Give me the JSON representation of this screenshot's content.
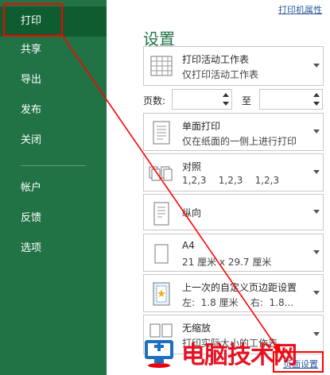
{
  "sidebar": {
    "items": [
      {
        "label": "打印",
        "active": true
      },
      {
        "label": "共享"
      },
      {
        "label": "导出"
      },
      {
        "label": "发布"
      },
      {
        "label": "关闭"
      },
      {
        "label": "帐户"
      },
      {
        "label": "反馈"
      },
      {
        "label": "选项"
      }
    ]
  },
  "main": {
    "printer_properties_link": "打印机属性",
    "section_title": "设置",
    "print_what": {
      "title": "打印活动工作表",
      "subtitle": "仅打印活动工作表"
    },
    "pages": {
      "label": "页数:",
      "to_label": "至",
      "from_value": "",
      "to_value": ""
    },
    "sides": {
      "title": "单面打印",
      "subtitle": "仅在纸面的一侧上进行打印"
    },
    "collation": {
      "title": "对照",
      "subtitle": "1,2,3    1,2,3    1,2,3"
    },
    "orientation": {
      "title": "纵向"
    },
    "paper": {
      "title": "A4",
      "subtitle": "21 厘米 x 29.7 厘米"
    },
    "margins": {
      "title": "上一次的自定义页边距设置",
      "subtitle": "左:  1.8 厘米    右:  1.8..."
    },
    "scaling": {
      "title": "无缩放",
      "subtitle": "打印实际大小的工作表"
    },
    "page_setup_link": "页面设置"
  },
  "watermark": {
    "text": "电脑技术网"
  },
  "colors": {
    "sidebar_bg": "#217346",
    "active_bg": "#0e5c2f",
    "annotation": "#ff0000",
    "accent": "#217346"
  }
}
